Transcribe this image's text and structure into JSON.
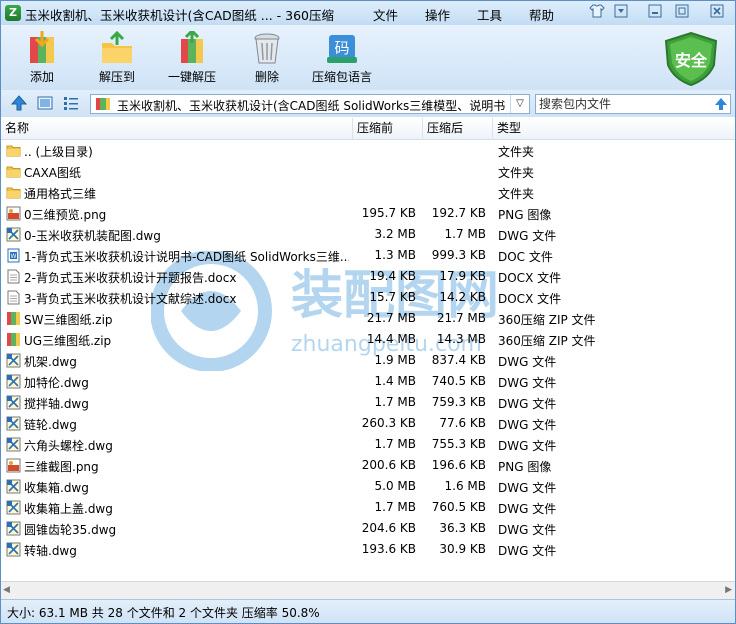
{
  "window": {
    "title": "玉米收割机、玉米收获机设计(含CAD图纸 ... - 360压缩",
    "menus": [
      "文件",
      "操作",
      "工具",
      "帮助"
    ],
    "app_icon": "360-zip-icon"
  },
  "toolbar": {
    "add_label": "添加",
    "extract_to_label": "解压到",
    "one_click_extract_label": "一键解压",
    "delete_label": "删除",
    "language_label": "压缩包语言",
    "language_icon_char": "码",
    "security_label": "安全"
  },
  "address": {
    "path": "玉米收割机、玉米收获机设计(含CAD图纸 SolidWorks三维模型、说明书",
    "search_placeholder": "搜索包内文件"
  },
  "columns": {
    "name": "名称",
    "compressed": "压缩前",
    "size_after": "压缩后",
    "type": "类型"
  },
  "files": [
    {
      "icon": "folder-up",
      "name": ".. (上级目录)",
      "before": "",
      "after": "",
      "type": "文件夹"
    },
    {
      "icon": "folder",
      "name": "CAXA图纸",
      "before": "",
      "after": "",
      "type": "文件夹"
    },
    {
      "icon": "folder",
      "name": "通用格式三维",
      "before": "",
      "after": "",
      "type": "文件夹"
    },
    {
      "icon": "png",
      "name": "0三维预览.png",
      "before": "195.7 KB",
      "after": "192.7 KB",
      "type": "PNG 图像"
    },
    {
      "icon": "dwg",
      "name": "0-玉米收获机装配图.dwg",
      "before": "3.2 MB",
      "after": "1.7 MB",
      "type": "DWG 文件"
    },
    {
      "icon": "doc",
      "name": "1-背负式玉米收获机设计说明书-CAD图纸 SolidWorks三维...",
      "before": "1.3 MB",
      "after": "999.3 KB",
      "type": "DOC 文件"
    },
    {
      "icon": "docx",
      "name": "2-背负式玉米收获机设计开题报告.docx",
      "before": "19.4 KB",
      "after": "17.9 KB",
      "type": "DOCX 文件"
    },
    {
      "icon": "docx",
      "name": "3-背负式玉米收获机设计文献综述.docx",
      "before": "15.7 KB",
      "after": "14.2 KB",
      "type": "DOCX 文件"
    },
    {
      "icon": "zip",
      "name": "SW三维图纸.zip",
      "before": "21.7 MB",
      "after": "21.7 MB",
      "type": "360压缩 ZIP 文件"
    },
    {
      "icon": "zip",
      "name": "UG三维图纸.zip",
      "before": "14.4 MB",
      "after": "14.3 MB",
      "type": "360压缩 ZIP 文件"
    },
    {
      "icon": "dwg",
      "name": "机架.dwg",
      "before": "1.9 MB",
      "after": "837.4 KB",
      "type": "DWG 文件"
    },
    {
      "icon": "dwg",
      "name": "加特伦.dwg",
      "before": "1.4 MB",
      "after": "740.5 KB",
      "type": "DWG 文件"
    },
    {
      "icon": "dwg",
      "name": "搅拌轴.dwg",
      "before": "1.7 MB",
      "after": "759.3 KB",
      "type": "DWG 文件"
    },
    {
      "icon": "dwg",
      "name": "链轮.dwg",
      "before": "260.3 KB",
      "after": "77.6 KB",
      "type": "DWG 文件"
    },
    {
      "icon": "dwg",
      "name": "六角头螺栓.dwg",
      "before": "1.7 MB",
      "after": "755.3 KB",
      "type": "DWG 文件"
    },
    {
      "icon": "png",
      "name": "三维截图.png",
      "before": "200.6 KB",
      "after": "196.6 KB",
      "type": "PNG 图像"
    },
    {
      "icon": "dwg",
      "name": "收集箱.dwg",
      "before": "5.0 MB",
      "after": "1.6 MB",
      "type": "DWG 文件"
    },
    {
      "icon": "dwg",
      "name": "收集箱上盖.dwg",
      "before": "1.7 MB",
      "after": "760.5 KB",
      "type": "DWG 文件"
    },
    {
      "icon": "dwg",
      "name": "圆锥齿轮35.dwg",
      "before": "204.6 KB",
      "after": "36.3 KB",
      "type": "DWG 文件"
    },
    {
      "icon": "dwg",
      "name": "转轴.dwg",
      "before": "193.6 KB",
      "after": "30.9 KB",
      "type": "DWG 文件"
    }
  ],
  "watermark": {
    "title": "装配图网",
    "url": "zhuangpeitu.com"
  },
  "status": {
    "text": "大小: 63.1 MB 共 28 个文件和 2 个文件夹 压缩率 50.8%"
  }
}
